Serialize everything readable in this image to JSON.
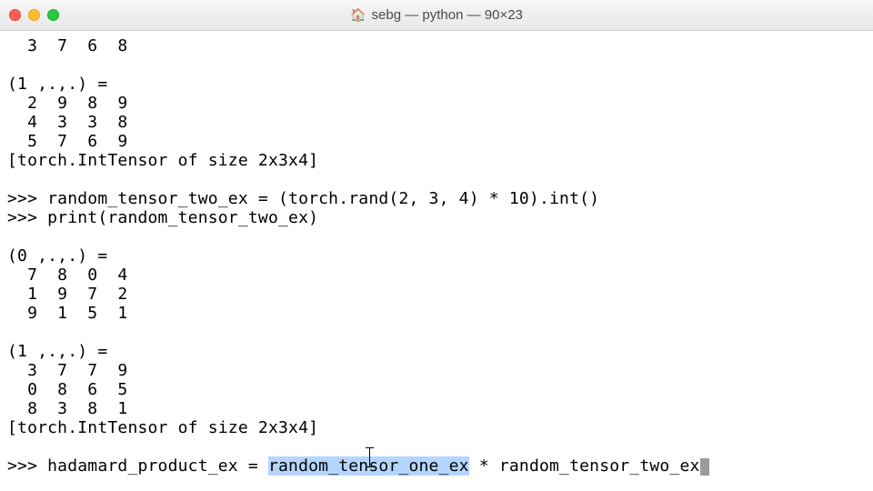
{
  "window": {
    "title": "sebg — python — 90×23"
  },
  "output": {
    "row_top": "  3  7  6  8",
    "blank1": "",
    "slice1_header": "(1 ,.,.) =",
    "slice1_r1": "  2  9  8  9",
    "slice1_r2": "  4  3  3  8",
    "slice1_r3": "  5  7  6  9",
    "type1": "[torch.IntTensor of size 2x3x4]",
    "blank2": "",
    "cmd1": ">>> random_tensor_two_ex = (torch.rand(2, 3, 4) * 10).int()",
    "cmd2": ">>> print(random_tensor_two_ex)",
    "blank3": "",
    "slice0b_header": "(0 ,.,.) =",
    "slice0b_r1": "  7  8  0  4",
    "slice0b_r2": "  1  9  7  2",
    "slice0b_r3": "  9  1  5  1",
    "blank4": "",
    "slice1b_header": "(1 ,.,.) =",
    "slice1b_r1": "  3  7  7  9",
    "slice1b_r2": "  0  8  6  5",
    "slice1b_r3": "  8  3  8  1",
    "type2": "[torch.IntTensor of size 2x3x4]",
    "blank5": ""
  },
  "prompt": {
    "prefix": ">>> hadamard_product_ex = ",
    "selected": "random_tensor_one_ex",
    "suffix": " * random_tensor_two_ex"
  }
}
